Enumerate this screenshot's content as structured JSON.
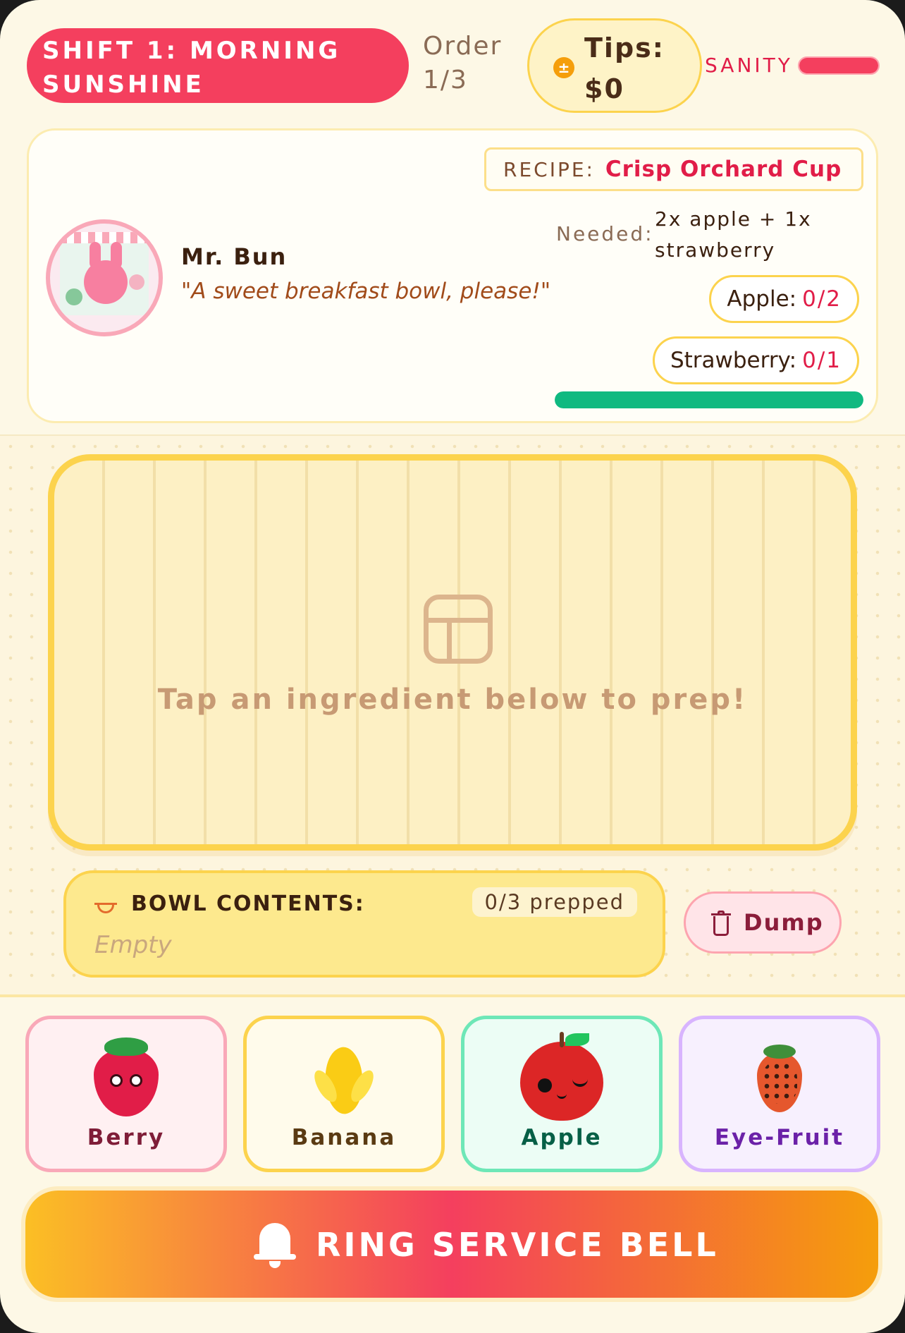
{
  "header": {
    "shift_title": "SHIFT 1: MORNING SUNSHINE",
    "order_label": "Order",
    "order_count": "1/3",
    "tips_label": "Tips:",
    "tips_value": "$0",
    "coin_icon": "coin-icon",
    "sanity_label": "SANITY",
    "sanity_level": 1.0
  },
  "customer": {
    "name": "Mr. Bun",
    "quote": "\"A sweet breakfast bowl, please!\"",
    "recipe_label": "RECIPE:",
    "recipe_name": "Crisp Orchard Cup",
    "needed_label": "Needed:",
    "needed_value": "2x apple + 1x strawberry",
    "requirements": [
      {
        "label": "Apple:",
        "count": "0/2"
      },
      {
        "label": "Strawberry:",
        "count": "0/1"
      }
    ],
    "patience_level": 1.0
  },
  "board": {
    "hint": "Tap an ingredient below to prep!",
    "icon": "cutting-board-icon"
  },
  "bowl": {
    "label": "BOWL CONTENTS:",
    "count": "0/3 prepped",
    "empty_text": "Empty",
    "dump_label": "Dump"
  },
  "ingredients": [
    {
      "name": "Berry",
      "icon": "strawberry-icon"
    },
    {
      "name": "Banana",
      "icon": "banana-icon"
    },
    {
      "name": "Apple",
      "icon": "apple-icon"
    },
    {
      "name": "Eye-Fruit",
      "icon": "eye-fruit-icon"
    }
  ],
  "bell": {
    "label": "RING SERVICE BELL",
    "icon": "bell-icon"
  },
  "colors": {
    "accent": "#f43f5e",
    "gold": "#fcd34d",
    "progress": "#10b981",
    "background": "#fdf8e6"
  }
}
